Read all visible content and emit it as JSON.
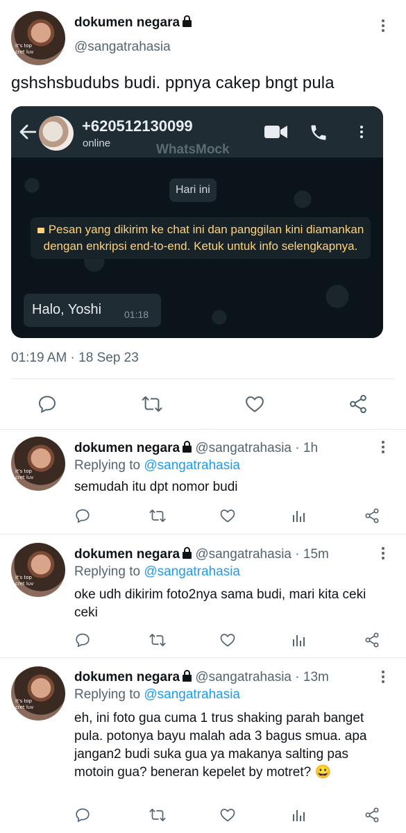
{
  "main": {
    "author_name": "dokumen negara",
    "author_handle": "@sangatrahasia",
    "avatar_caption_1": "it's top",
    "avatar_caption_2": "cret luv",
    "text": "gshshsbudubs budi. ppnya cakep bngt pula",
    "timestamp": "01:19 AM · 18 Sep 23"
  },
  "whatsapp": {
    "contact_number": "+620512130099",
    "status": "online",
    "watermark": "WhatsMock",
    "date_chip": "Hari ini",
    "encryption_notice": "Pesan yang dikirim ke chat ini dan panggilan kini diamankan dengan enkripsi end-to-end. Ketuk untuk info selengkapnya.",
    "message_text": "Halo, Yoshi",
    "message_time": "01:18"
  },
  "replies": [
    {
      "name": "dokumen negara",
      "handle": "@sangatrahasia",
      "time": "· 1h",
      "replying_prefix": "Replying to",
      "replying_to": "@sangatrahasia",
      "text": "semudah itu dpt nomor budi"
    },
    {
      "name": "dokumen negara",
      "handle": "@sangatrahasia",
      "time": "· 15m",
      "replying_prefix": "Replying to",
      "replying_to": "@sangatrahasia",
      "text": "oke udh dikirim foto2nya sama budi, mari kita ceki ceki"
    },
    {
      "name": "dokumen negara",
      "handle": "@sangatrahasia",
      "time": "· 13m",
      "replying_prefix": "Replying to",
      "replying_to": "@sangatrahasia",
      "text": "eh, ini foto gua cuma 1 trus shaking parah banget pula. potonya bayu malah ada 3 bagus smua. apa jangan2 budi suka gua ya makanya salting pas motoin gua? beneran kepelet by motret? 😀"
    }
  ],
  "colors": {
    "text": "#0f1419",
    "secondary": "#536471",
    "link": "#1d9bf0",
    "divider": "#e7e9ea",
    "wa_header": "#1f2c34",
    "wa_background": "#0b141a",
    "wa_notice": "#ffd279"
  },
  "icons": [
    "lock-icon",
    "more-icon",
    "reply-icon",
    "retweet-icon",
    "like-icon",
    "share-icon",
    "analytics-icon",
    "back-arrow-icon",
    "video-call-icon",
    "phone-icon",
    "padlock-icon"
  ]
}
